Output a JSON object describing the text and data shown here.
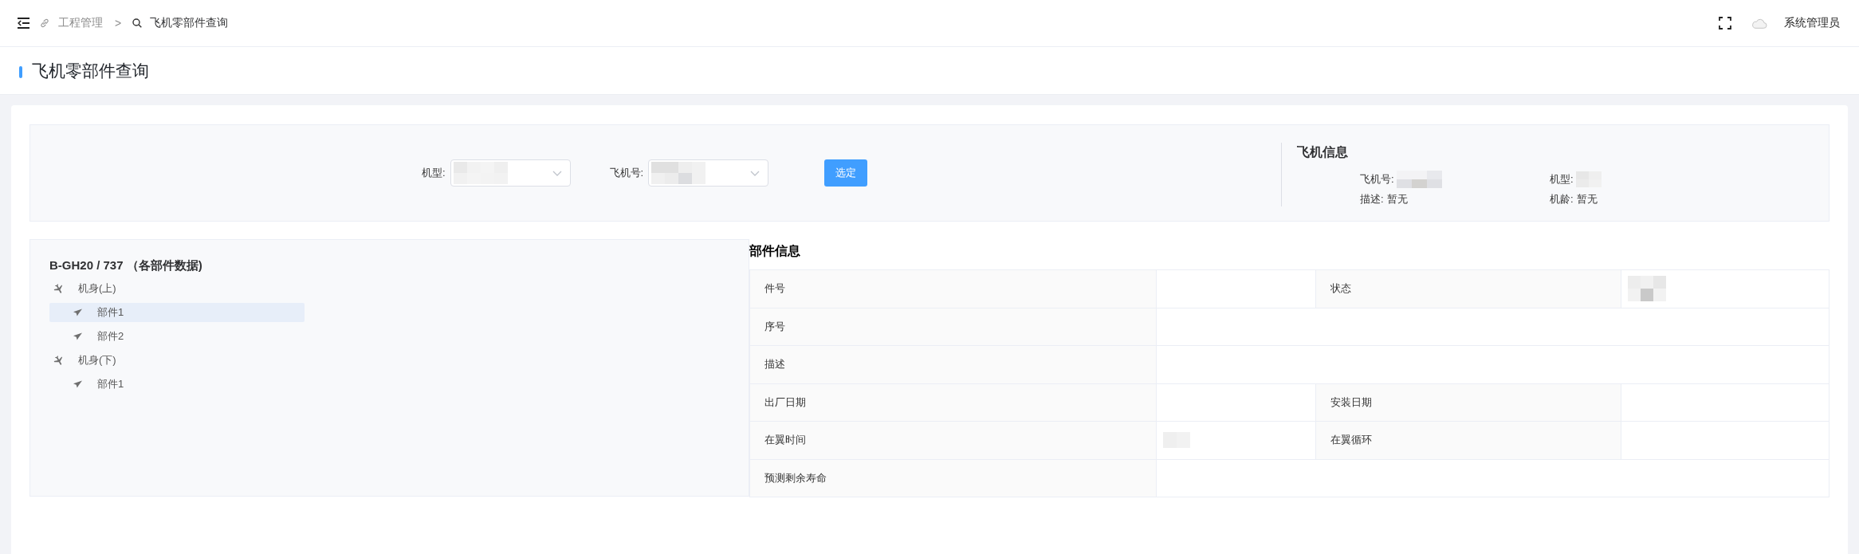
{
  "header": {
    "breadcrumb": [
      {
        "label": "工程管理"
      },
      {
        "label": "飞机零部件查询"
      }
    ],
    "separator": ">",
    "user": "系统管理员"
  },
  "page_title": "飞机零部件查询",
  "filters": {
    "fields": [
      {
        "label": "机型:",
        "value_blurred": true
      },
      {
        "label": "飞机号:",
        "value_blurred": true
      }
    ],
    "button": "选定"
  },
  "aircraft_info": {
    "title": "飞机信息",
    "fields": [
      {
        "label": "飞机号:",
        "value_blurred": true
      },
      {
        "label": "机型:",
        "value_blurred": true
      },
      {
        "label": "描述:",
        "value": "暂无",
        "value_blurred": false
      },
      {
        "label": "机龄:",
        "value": "暂无",
        "value_blurred": false
      }
    ]
  },
  "tree": {
    "title": "B-GH20 / 737 （各部件数据)",
    "items": [
      {
        "label": "机身(上)",
        "selected": false,
        "children": [
          {
            "label": "部件1",
            "selected": true
          },
          {
            "label": "部件2",
            "selected": false
          }
        ]
      },
      {
        "label": "机身(下)",
        "selected": false,
        "children": [
          {
            "label": "部件1",
            "selected": false
          }
        ]
      }
    ]
  },
  "part_info": {
    "title": "部件信息",
    "rows": [
      {
        "fields": [
          {
            "label": "件号",
            "value_blurred": false
          },
          {
            "label": "状态",
            "value_blurred": true
          }
        ]
      },
      {
        "fields": [
          {
            "label": "序号",
            "value_blurred": false
          }
        ]
      },
      {
        "fields": [
          {
            "label": "描述",
            "value_blurred": false
          }
        ]
      },
      {
        "fields": [
          {
            "label": "出厂日期",
            "value_blurred": false
          },
          {
            "label": "安装日期",
            "value_blurred": false
          }
        ]
      },
      {
        "fields": [
          {
            "label": "在翼时间",
            "value_blurred": true
          },
          {
            "label": "在翼循环",
            "value_blurred": false
          }
        ]
      },
      {
        "fields": [
          {
            "label": "预测剩余寿命",
            "value_blurred": false
          }
        ]
      }
    ]
  }
}
